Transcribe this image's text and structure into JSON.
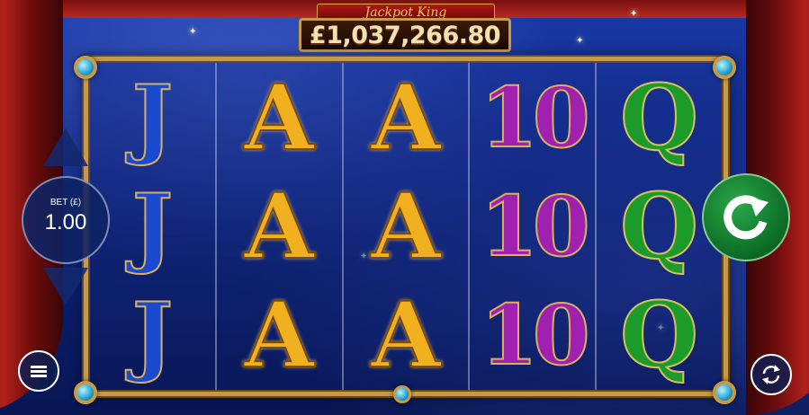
{
  "jackpot": {
    "brand": "Jackpot King",
    "amount": "£1,037,266.80"
  },
  "bet": {
    "label": "BET (£)",
    "value": "1.00"
  },
  "reels": [
    [
      "J",
      "J",
      "J"
    ],
    [
      "A",
      "A",
      "A"
    ],
    [
      "A",
      "A",
      "A"
    ],
    [
      "10",
      "10",
      "10"
    ],
    [
      "Q",
      "Q",
      "Q"
    ]
  ],
  "icons": {
    "bet_up": "triangle-up-icon",
    "bet_down": "triangle-down-icon",
    "spin": "spin-arrow-icon",
    "menu": "hamburger-icon",
    "autoplay": "refresh-icon"
  },
  "colors": {
    "spin_button": "#0b6a25",
    "frame_gold": "#c79a4a",
    "jackpot_text": "#f6e0b0"
  }
}
